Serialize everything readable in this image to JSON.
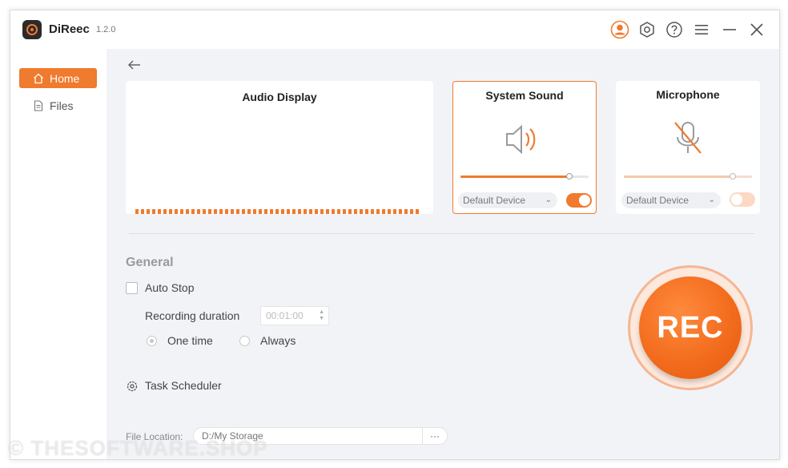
{
  "app": {
    "name": "DiReec",
    "version": "1.2.0"
  },
  "titlebar_icons": [
    "user-icon",
    "settings-icon",
    "help-icon",
    "menu-icon",
    "minimize-icon",
    "close-icon"
  ],
  "sidebar": {
    "items": [
      {
        "label": "Home",
        "icon": "home-icon",
        "active": true
      },
      {
        "label": "Files",
        "icon": "file-icon",
        "active": false
      }
    ]
  },
  "audio_display": {
    "title": "Audio Display"
  },
  "system_sound": {
    "title": "System Sound",
    "device": "Default Device",
    "enabled": true,
    "volume": 0.85
  },
  "microphone": {
    "title": "Microphone",
    "device": "Default Device",
    "enabled": false,
    "volume": 0.85
  },
  "general": {
    "title": "General",
    "auto_stop": {
      "label": "Auto Stop",
      "checked": false
    },
    "recording_duration": {
      "label": "Recording duration",
      "value": "00:01:00"
    },
    "one_time": "One time",
    "always": "Always",
    "task_scheduler": "Task Scheduler"
  },
  "rec_button": {
    "label": "REC"
  },
  "file_location": {
    "label": "File Location:",
    "value": "D:/My Storage",
    "more": "···"
  },
  "watermark": "© THESOFTWARE.SHOP",
  "colors": {
    "accent": "#f07a2e",
    "accent_light": "#f5c9ab"
  }
}
